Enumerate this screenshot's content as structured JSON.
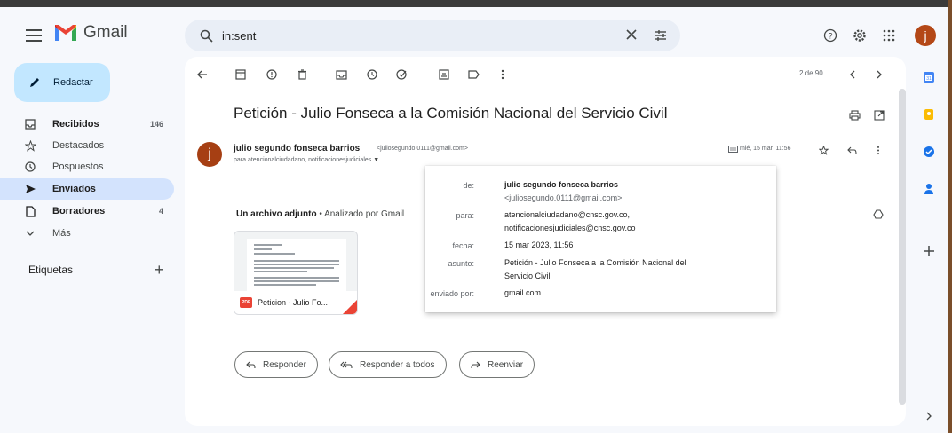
{
  "app": {
    "name": "Gmail"
  },
  "search": {
    "value": "in:sent"
  },
  "user": {
    "avatar_letter": "j"
  },
  "compose": {
    "label": "Redactar"
  },
  "sidebar": {
    "items": [
      {
        "label": "Recibidos",
        "count": "146"
      },
      {
        "label": "Destacados",
        "count": ""
      },
      {
        "label": "Pospuestos",
        "count": ""
      },
      {
        "label": "Enviados",
        "count": ""
      },
      {
        "label": "Borradores",
        "count": "4"
      },
      {
        "label": "Más",
        "count": ""
      }
    ],
    "labels_title": "Etiquetas"
  },
  "toolbar": {
    "counter": "2 de 90"
  },
  "email": {
    "subject": "Petición - Julio Fonseca a la Comisión Nacional del Servicio Civil",
    "sender_name": "julio segundo fonseca barrios",
    "sender_email": "<juliosegundo.0111@gmail.com>",
    "to_line": "para atencionalciudadano, notificacionesjudiciales",
    "date": "mié, 15 mar, 11:56",
    "avatar_letter": "j"
  },
  "attachment": {
    "title_bold": "Un archivo adjunto",
    "title_sub": " • Analizado por Gmail",
    "file_name": "Peticion - Julio Fo...",
    "type_badge": "PDF"
  },
  "details_popup": {
    "from_label": "de:",
    "from_name": "julio segundo fonseca barrios",
    "from_email": "<juliosegundo.0111@gmail.com>",
    "to_label": "para:",
    "to_1": "atencionalciudadano@cnsc.gov.co,",
    "to_2": "notificacionesjudiciales@cnsc.gov.co",
    "date_label": "fecha:",
    "date_value": "15 mar 2023, 11:56",
    "subject_label": "asunto:",
    "subject_1": "Petición - Julio Fonseca a la Comisión Nacional del",
    "subject_2": "Servicio Civil",
    "sent_by_label": "enviado por:",
    "sent_by_value": "gmail.com"
  },
  "actions": {
    "reply": "Responder",
    "reply_all": "Responder a todos",
    "forward": "Reenviar"
  },
  "colors": {
    "accent": "#c2e7ff",
    "active_nav": "#d3e3fd",
    "avatar": "#b44817"
  }
}
